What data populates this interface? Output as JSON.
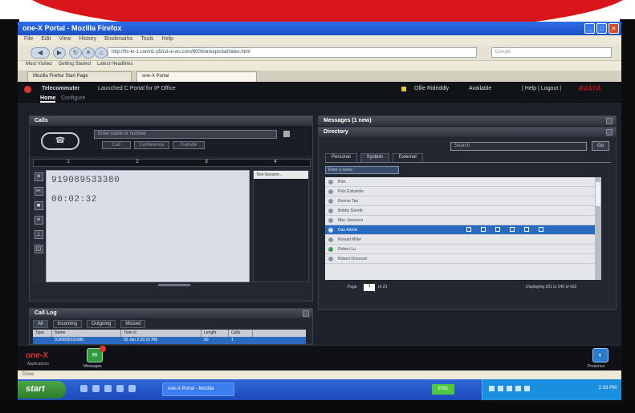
{
  "colors": {
    "brand_red": "#d8151b",
    "app_bg": "#1d2129",
    "selection_blue": "#2a6bc2",
    "xp_blue": "#1b4fc4"
  },
  "browser": {
    "title": "one-X Portal - Mozilla Firefox",
    "menu": [
      "File",
      "Edit",
      "View",
      "History",
      "Bookmarks",
      "Tools",
      "Help"
    ],
    "url": "http://fm-kr-1.com/i1-p5/cd-ui-ws.com/6000/onexportal/index.html",
    "search_placeholder": "Google",
    "bookmarks": [
      "Most Visited",
      "Getting Started",
      "Latest Headlines"
    ],
    "tabs": [
      "Mozilla Firefox Start Page",
      "one-X Portal"
    ]
  },
  "app": {
    "header_title": "Telecommuter",
    "header_subtitle": "Launched C Portal for IP Office",
    "nav_home": "Home",
    "nav_configure": "Configure",
    "user": "Ollie Ridriddly",
    "availability": "Available",
    "links": "| Help | Logout |",
    "brand": "AVAYA"
  },
  "calls": {
    "title": "Calls",
    "phone_icon": "phone-handset-icon",
    "dial_placeholder": "Enter name or number",
    "buttons": [
      "Call",
      "Conference",
      "Transfer"
    ],
    "lines": [
      "1",
      "2",
      "3",
      "4"
    ],
    "number": "919089533380",
    "duration": "00:02:32",
    "sessions_label": "Text-Session..."
  },
  "call_log": {
    "title": "Call Log",
    "tabs": [
      "All",
      "Incoming",
      "Outgoing",
      "Missed"
    ],
    "columns": [
      "Type",
      "Name",
      "Time in",
      "Length",
      "Calls"
    ],
    "row": [
      "",
      "9190895333380",
      "03 Jan 2:33:10 PM",
      "00",
      "1"
    ]
  },
  "messages": {
    "title": "Messages (1 new)"
  },
  "directory": {
    "title": "Directory",
    "search_placeholder": "Search",
    "go": "Go",
    "tabs": [
      "Personal",
      "System",
      "External"
    ],
    "filter_placeholder": "Enter a name",
    "items": [
      "Rick",
      "Rick Extramile",
      "Ronnie Tan",
      "Bobby Geretti",
      "Mac Jameson",
      "Dan Admin",
      "Ronald Miller",
      "Robert Lu",
      "Robert Donovan"
    ],
    "selected_index": 5,
    "page_label": "Page",
    "page_value": "1",
    "page_total": "of 23",
    "summary": "Displaying 201 to 240 of 422"
  },
  "appbar": {
    "logo": "one-X",
    "logo_sub": "Applications",
    "messages_label": "Messages",
    "presence_label": "Presence"
  },
  "statusbar": {
    "text": "Done"
  },
  "taskbar": {
    "start": "start",
    "task": "one-X Portal - Mozilla",
    "tray_green": "ENG",
    "clock": "2:33 PM"
  }
}
